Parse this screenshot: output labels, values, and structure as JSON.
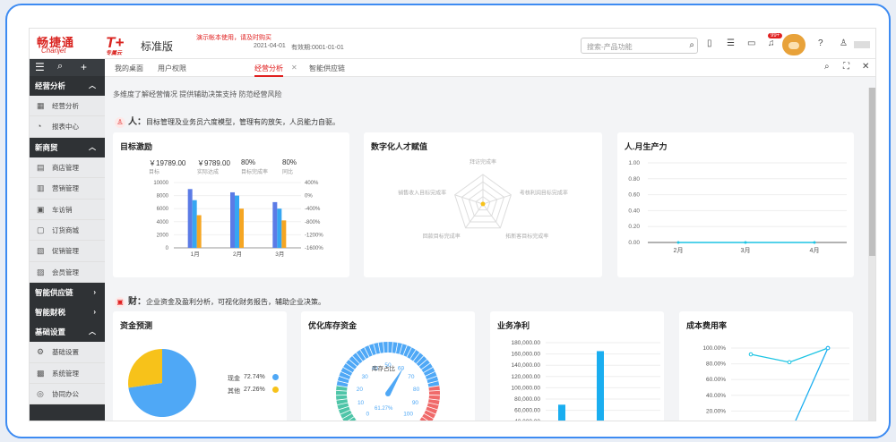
{
  "header": {
    "logo_cn": "畅捷通",
    "logo_en": "Chanjet",
    "product": "T+",
    "product_sub": "专属云",
    "edition": "标准版",
    "notice": "演示帐本使用，请及时购买",
    "date": "2021-04-01",
    "valid": "有效期:0001-01-01",
    "search_placeholder": "搜索-产品功能",
    "badge": "99+"
  },
  "sidebar": {
    "groups": [
      {
        "label": "经营分析",
        "items": [
          {
            "label": "经营分析"
          },
          {
            "label": "报表中心"
          }
        ]
      },
      {
        "label": "新商贸",
        "items": [
          {
            "label": "商店管理"
          },
          {
            "label": "营销管理"
          },
          {
            "label": "车访销"
          },
          {
            "label": "订货商城"
          },
          {
            "label": "促销管理"
          },
          {
            "label": "会员管理"
          }
        ]
      },
      {
        "label": "智能供应链",
        "items": []
      },
      {
        "label": "智能财税",
        "items": []
      },
      {
        "label": "基础设置",
        "items": [
          {
            "label": "基础设置"
          },
          {
            "label": "系统管理"
          },
          {
            "label": "协同办公"
          }
        ]
      }
    ]
  },
  "tabs": [
    {
      "label": "我的桌面"
    },
    {
      "label": "用户权限"
    },
    {
      "label": "经营分析"
    },
    {
      "label": "智能供应链"
    }
  ],
  "page": {
    "tagline": "多维度了解经营情况 提供辅助决策支持 防范经营风险",
    "people_title": "人：",
    "people_desc": "目标管理及业务员六度模型，管理有的放矢，人员能力自驱。",
    "finance_title": "财：",
    "finance_desc": "企业资金及盈利分析，可视化财务报告，辅助企业决策。"
  },
  "target": {
    "title": "目标激励",
    "metrics": [
      {
        "value": "￥19789.00",
        "label": "目标"
      },
      {
        "value": "￥9789.00",
        "label": "实际达成"
      },
      {
        "value": "80%",
        "label": "目标完成率"
      },
      {
        "value": "80%",
        "label": "同比"
      }
    ]
  },
  "talent": {
    "title": "数字化人才赋值"
  },
  "productivity": {
    "title": "人.月生产力"
  },
  "cash": {
    "title": "资金预测",
    "legend": [
      {
        "label": "现金",
        "pct": "72.74%"
      },
      {
        "label": "其他",
        "pct": "27.26%"
      }
    ]
  },
  "inventory": {
    "title": "优化库存资金",
    "center_label": "库存占比",
    "value_label": "61.27%"
  },
  "profit": {
    "title": "业务净利"
  },
  "costrate": {
    "title": "成本费用率"
  },
  "chart_data": [
    {
      "type": "bar",
      "title": "目标激励",
      "categories": [
        "1月",
        "2月",
        "3月"
      ],
      "series": [
        {
          "values": [
            9000,
            8500,
            7000
          ]
        },
        {
          "values": [
            7300,
            8000,
            6000
          ]
        },
        {
          "values": [
            5000,
            6000,
            4200
          ]
        }
      ],
      "y_left": {
        "ylim": [
          0,
          10000
        ],
        "ticks": [
          "0",
          "2000",
          "4000",
          "6000",
          "8000",
          "10000"
        ]
      },
      "y_right": {
        "ticks": [
          "-1600%",
          "-1200%",
          "-800%",
          "-400%",
          "0%",
          "400%"
        ]
      }
    },
    {
      "type": "radar",
      "title": "数字化人才赋值",
      "indicators": [
        "拜访完成率",
        "考核利润目标完成率",
        "拓新客目标完成率",
        "回款目标完成率",
        "销售收入目标完成率"
      ]
    },
    {
      "type": "line",
      "title": "人.月生产力",
      "categories": [
        "2月",
        "3月",
        "4月"
      ],
      "values": [
        0,
        0,
        0
      ],
      "ylim": [
        0,
        1
      ],
      "yticks": [
        "0.00",
        "0.20",
        "0.40",
        "0.60",
        "0.80",
        "1.00"
      ]
    },
    {
      "type": "pie",
      "title": "资金预测",
      "labels": [
        "现金",
        "其他"
      ],
      "values": [
        72.74,
        27.26
      ],
      "colors": [
        "#4fa8f6",
        "#f7c21a"
      ]
    },
    {
      "type": "gauge",
      "title": "优化库存资金",
      "value": 61.27,
      "range": [
        0,
        100
      ],
      "ticks": [
        "0",
        "10",
        "20",
        "30",
        "40",
        "50",
        "60",
        "70",
        "80",
        "90",
        "100"
      ]
    },
    {
      "type": "bar",
      "title": "业务净利",
      "values": [
        70000,
        165000,
        -5000
      ],
      "ylim": [
        -20000,
        180000
      ],
      "yticks": [
        "0.00",
        "20,000.00",
        "40,000.00",
        "60,000.00",
        "80,000.00",
        "100,000.00",
        "120,000.00",
        "140,000.00",
        "160,000.00",
        "180,000.00"
      ]
    },
    {
      "type": "line",
      "title": "成本费用率",
      "series": [
        {
          "values": [
            92,
            82,
            100
          ]
        },
        {
          "values": [
            -20,
            -10,
            100
          ]
        }
      ],
      "ylim": [
        0,
        100
      ],
      "yticks": [
        "0.00%",
        "20.00%",
        "40.00%",
        "60.00%",
        "80.00%",
        "100.00%"
      ]
    }
  ]
}
